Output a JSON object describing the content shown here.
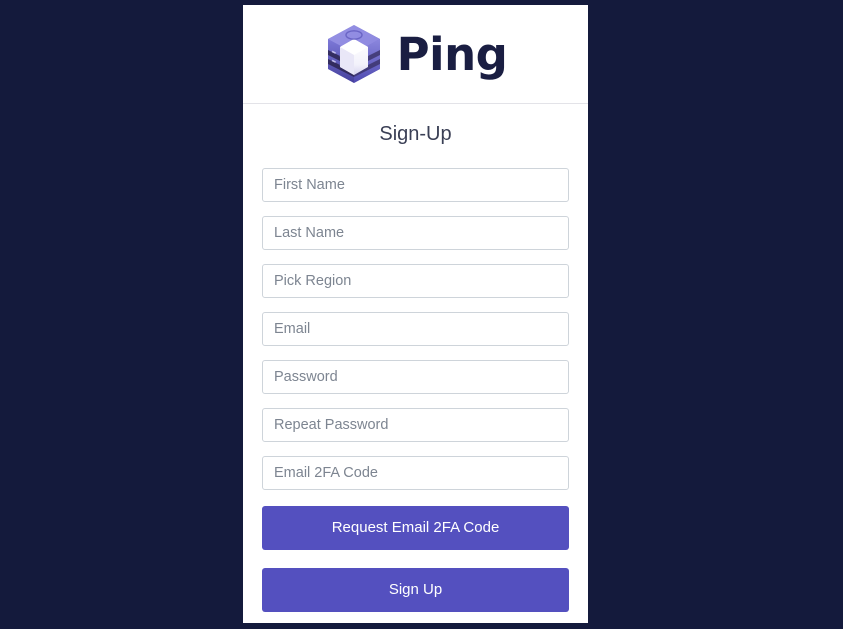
{
  "theme": {
    "page_background": "#141a3c",
    "card_background": "#ffffff",
    "accent": "#5450bf",
    "brand_text_color": "#1a1e42",
    "field_border": "#ced4da",
    "placeholder_color": "#7d8591"
  },
  "brand": {
    "name": "Ping",
    "logo_icon": "isometric-cube-icon"
  },
  "form": {
    "title": "Sign-Up",
    "fields": [
      {
        "name": "first-name-input",
        "placeholder": "First Name",
        "type": "text"
      },
      {
        "name": "last-name-input",
        "placeholder": "Last Name",
        "type": "text"
      },
      {
        "name": "pick-region-select",
        "placeholder": "Pick Region",
        "type": "select"
      },
      {
        "name": "email-input",
        "placeholder": "Email",
        "type": "email"
      },
      {
        "name": "password-input",
        "placeholder": "Password",
        "type": "password"
      },
      {
        "name": "repeat-password-input",
        "placeholder": "Repeat Password",
        "type": "password"
      },
      {
        "name": "email-2fa-code-input",
        "placeholder": "Email 2FA Code",
        "type": "text"
      }
    ],
    "buttons": {
      "request_code": "Request Email 2FA Code",
      "submit": "Sign Up"
    }
  }
}
